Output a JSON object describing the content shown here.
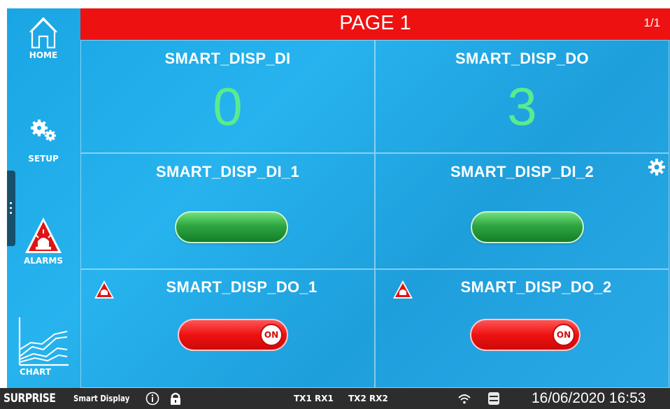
{
  "header": {
    "title": "PAGE 1",
    "page_index": "1/1"
  },
  "sidebar": {
    "items": [
      {
        "label": "HOME",
        "icon": "home-icon"
      },
      {
        "label": "SETUP",
        "icon": "gears-icon"
      },
      {
        "label": "ALARMS",
        "icon": "alarm-beacon-icon"
      },
      {
        "label": "CHART",
        "icon": "chart-icon"
      }
    ]
  },
  "cells": [
    {
      "title": "SMART_DISP_DI",
      "value": "0"
    },
    {
      "title": "SMART_DISP_DO",
      "value": "3"
    },
    {
      "title": "SMART_DISP_DI_1",
      "state": "on"
    },
    {
      "title": "SMART_DISP_DI_2",
      "state": "on"
    },
    {
      "title": "SMART_DISP_DO_1",
      "toggle_label": "ON",
      "alarm": true
    },
    {
      "title": "SMART_DISP_DO_2",
      "toggle_label": "ON",
      "alarm": true
    }
  ],
  "statusbar": {
    "brand": "SURPRISE",
    "brand_sub": "Smart Display",
    "comm1": "TX1 RX1",
    "comm2": "TX2 RX2",
    "datetime": "16/06/2020 16:53"
  },
  "colors": {
    "header_red": "#ee1111",
    "value_green": "#58ec8f",
    "background_blue": "#1fa6e4",
    "statusbar": "#2d2d2d"
  }
}
